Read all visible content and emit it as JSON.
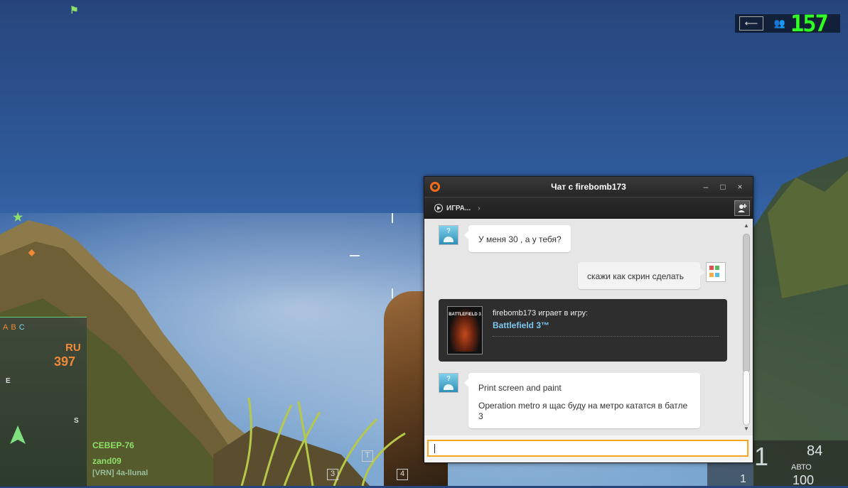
{
  "hud": {
    "fps": "157",
    "player_name_1": "СЕВЕР-76",
    "player_name_2": "zand09",
    "player_name_3": "[VRN] 4a-llunal",
    "region": "RU",
    "ticket_count": "397",
    "squad_letters": [
      "A",
      "B",
      "C"
    ],
    "compass_e": "E",
    "compass_s": "S",
    "slot_3": "3",
    "slot_4": "4",
    "slot_t": "T",
    "ammo_current": "1",
    "ammo_total": "84",
    "fire_mode": "АВТО",
    "grenades": "1",
    "health": "100"
  },
  "chat_window": {
    "title": "Чат с firebomb173",
    "toolbar": {
      "games_label": "ИГРА...",
      "chevron": "›"
    },
    "window_controls": {
      "minimize": "–",
      "maximize": "□",
      "close": "×"
    },
    "messages": [
      {
        "from": "friend",
        "lines": [
          "У меня 30 , а у тебя?"
        ]
      },
      {
        "from": "self",
        "lines": [
          "скажи как скрин сделать"
        ]
      },
      {
        "from": "friend",
        "lines": [
          "Print screen and paint",
          "Operation metro я щас буду на метро кататся в батле 3"
        ]
      }
    ],
    "game_card": {
      "status": "firebomb173 играет в игру:",
      "game": "Battlefield 3™",
      "cover_text": "BATTLEFIELD 3"
    },
    "input": {
      "value": "",
      "placeholder": ""
    }
  },
  "colors": {
    "origin_orange": "#f56c1b",
    "input_border": "#f5a623",
    "link_blue": "#7ec8f0",
    "hud_green": "#8fe06a",
    "fps_green": "#32ff2a"
  },
  "icons": {
    "back": "back-arrow-icon",
    "friends": "friends-icon",
    "globe": "globe-icon",
    "add_friend": "add-friend-icon"
  }
}
